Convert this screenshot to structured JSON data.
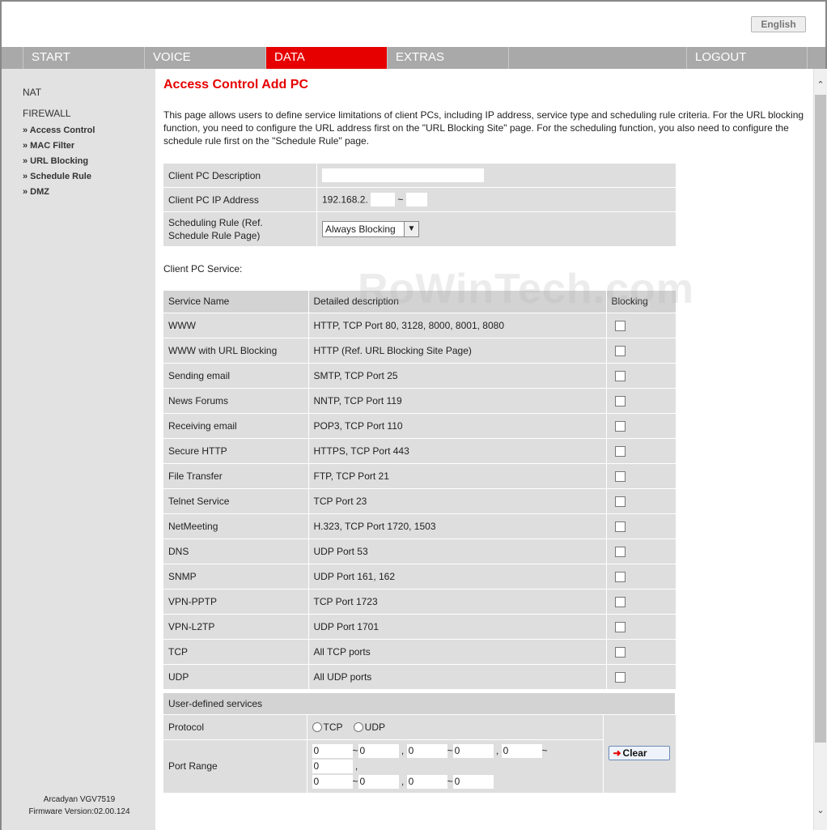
{
  "header": {
    "language_button": "English"
  },
  "nav": {
    "items": [
      {
        "label": "START"
      },
      {
        "label": "VOICE"
      },
      {
        "label": "DATA"
      },
      {
        "label": "EXTRAS"
      },
      {
        "label": ""
      },
      {
        "label": "LOGOUT"
      }
    ],
    "active": "DATA",
    "active_color": "#e60000"
  },
  "sidebar": {
    "categories": [
      {
        "label": "NAT"
      },
      {
        "label": "FIREWALL"
      }
    ],
    "links": [
      {
        "label": "» Access Control"
      },
      {
        "label": "» MAC Filter"
      },
      {
        "label": "» URL Blocking"
      },
      {
        "label": "» Schedule Rule"
      },
      {
        "label": "» DMZ"
      }
    ],
    "footer": {
      "model": "Arcadyan VGV7519",
      "firmware": "Firmware Version:02.00.124"
    }
  },
  "main": {
    "title": "Access Control Add PC",
    "intro": "This page allows users to define service limitations of client PCs, including IP address, service type and scheduling rule criteria. For the URL blocking function, you need to configure the URL address first on the \"URL Blocking Site\" page. For the scheduling function, you also need to configure the schedule rule first on the \"Schedule Rule\" page.",
    "form": {
      "description_label": "Client PC Description",
      "description_value": "",
      "ip_label": "Client PC IP Address",
      "ip_prefix": "192.168.2.",
      "ip_from": "",
      "ip_sep": "~",
      "ip_to": "",
      "schedule_label_1": "Scheduling Rule (Ref.",
      "schedule_label_2": "Schedule Rule Page)",
      "schedule_value": "Always Blocking"
    },
    "service_section_label": "Client PC Service:",
    "service_table": {
      "headers": {
        "name": "Service Name",
        "desc": "Detailed description",
        "block": "Blocking"
      },
      "rows": [
        {
          "name": "WWW",
          "desc": "HTTP, TCP Port 80, 3128, 8000, 8001, 8080",
          "checked": false
        },
        {
          "name": "WWW with URL Blocking",
          "desc": "HTTP (Ref. URL Blocking Site Page)",
          "checked": false
        },
        {
          "name": "Sending email",
          "desc": "SMTP, TCP Port 25",
          "checked": false
        },
        {
          "name": "News Forums",
          "desc": "NNTP, TCP Port 119",
          "checked": false
        },
        {
          "name": "Receiving email",
          "desc": "POP3, TCP Port 110",
          "checked": false
        },
        {
          "name": "Secure HTTP",
          "desc": "HTTPS, TCP Port 443",
          "checked": false
        },
        {
          "name": "File Transfer",
          "desc": "FTP, TCP Port 21",
          "checked": false
        },
        {
          "name": "Telnet Service",
          "desc": "TCP Port 23",
          "checked": false
        },
        {
          "name": "NetMeeting",
          "desc": "H.323, TCP Port 1720, 1503",
          "checked": false
        },
        {
          "name": "DNS",
          "desc": "UDP Port 53",
          "checked": false
        },
        {
          "name": "SNMP",
          "desc": "UDP Port 161, 162",
          "checked": false
        },
        {
          "name": "VPN-PPTP",
          "desc": "TCP Port 1723",
          "checked": false
        },
        {
          "name": "VPN-L2TP",
          "desc": "UDP Port 1701",
          "checked": false
        },
        {
          "name": "TCP",
          "desc": "All TCP ports",
          "checked": false
        },
        {
          "name": "UDP",
          "desc": "All UDP ports",
          "checked": false
        }
      ]
    },
    "user_defined": {
      "header": "User-defined services",
      "protocol_label": "Protocol",
      "protocol_tcp": "TCP",
      "protocol_udp": "UDP",
      "port_label": "Port Range",
      "range_sep": "~",
      "list_sep": ",",
      "ports": {
        "r1_from": "0",
        "r1_to": "0",
        "r2_from": "0",
        "r2_to": "0",
        "r3_from": "0",
        "r3_to": "0",
        "r4_from": "0",
        "r4_to": "0",
        "r5_from": "0",
        "r5_to": "0"
      },
      "clear_button": "Clear"
    }
  },
  "watermark": "RoWinTech.com"
}
